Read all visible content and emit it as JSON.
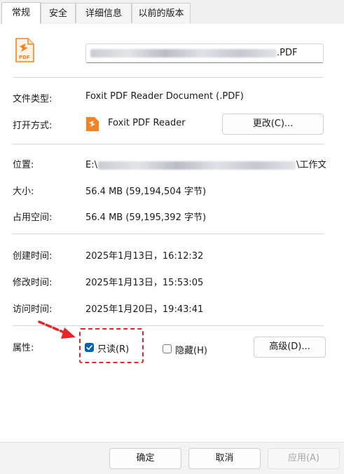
{
  "tabs": [
    "常规",
    "安全",
    "详细信息",
    "以前的版本"
  ],
  "file": {
    "name_suffix": ".PDF",
    "icon": "pdf-file-icon"
  },
  "rows": {
    "type_label": "文件类型:",
    "type_value": "Foxit PDF Reader Document (.PDF)",
    "open_label": "打开方式:",
    "open_value": "Foxit PDF Reader",
    "change_button": "更改(C)...",
    "location_label": "位置:",
    "location_prefix": "E:\\",
    "location_suffix": "\\工作文",
    "size_label": "大小:",
    "size_value": "56.4 MB (59,194,504 字节)",
    "disk_label": "占用空间:",
    "disk_value": "56.4 MB (59,195,392 字节)",
    "created_label": "创建时间:",
    "created_value": "2025年1月13日，16:12:32",
    "modified_label": "修改时间:",
    "modified_value": "2025年1月13日，15:53:05",
    "accessed_label": "访问时间:",
    "accessed_value": "2025年1月20日，19:43:41",
    "attr_label": "属性:",
    "readonly_label": "只读(R)",
    "hidden_label": "隐藏(H)",
    "advanced_button": "高级(D)..."
  },
  "footer": {
    "ok": "确定",
    "cancel": "取消",
    "apply": "应用(A)"
  },
  "colors": {
    "accent": "#0063b1",
    "annotation": "#e8242b",
    "pdf_orange": "#f58220"
  },
  "state": {
    "readonly_checked": true,
    "hidden_checked": false,
    "apply_enabled": false
  }
}
